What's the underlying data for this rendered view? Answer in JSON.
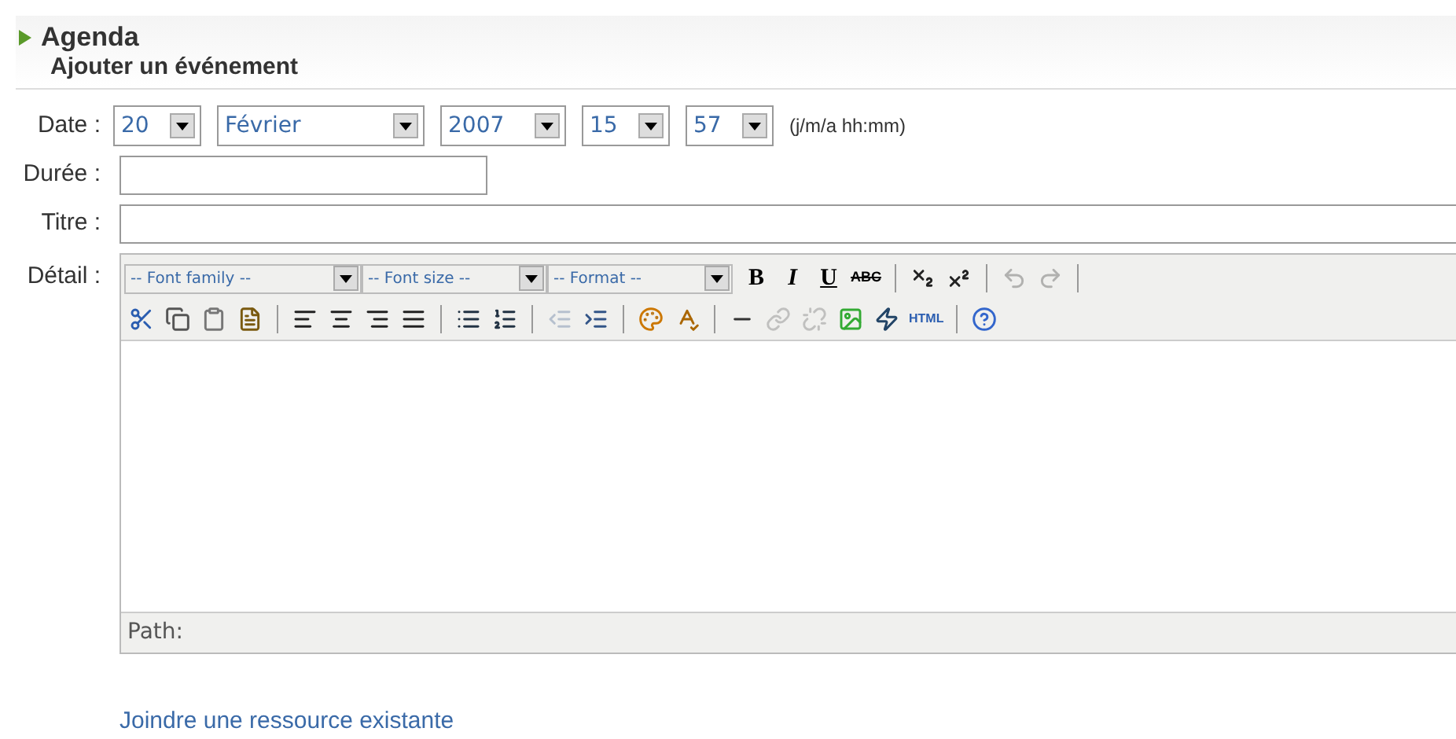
{
  "header": {
    "title": "Agenda",
    "subtitle": "Ajouter un événement"
  },
  "date": {
    "label": "Date :",
    "selects": [
      {
        "value": "20"
      },
      {
        "value": "Février"
      },
      {
        "value": "2007"
      },
      {
        "value": "15"
      },
      {
        "value": "57"
      }
    ],
    "hint": "(j/m/a hh:mm)"
  },
  "duration": {
    "label": "Durée :"
  },
  "title_field": {
    "label": "Titre :"
  },
  "detail": {
    "label": "Détail :",
    "dropdowns": [
      {
        "value": "-- Font family --"
      },
      {
        "value": "-- Font size --"
      },
      {
        "value": "-- Format --"
      }
    ],
    "row_1": [
      {
        "kind": "text",
        "label": "B",
        "disabled": false
      },
      {
        "kind": "text",
        "label": "I",
        "disabled": false
      },
      {
        "kind": "text",
        "label": "U",
        "disabled": false
      },
      {
        "kind": "text",
        "label": "ABC",
        "disabled": false
      },
      {
        "kind": "separator"
      },
      {
        "kind": "icon",
        "disabled": false
      },
      {
        "kind": "icon",
        "disabled": false
      },
      {
        "kind": "separator"
      },
      {
        "kind": "icon",
        "disabled": true
      },
      {
        "kind": "icon",
        "disabled": true
      },
      {
        "kind": "separator"
      }
    ],
    "row_2": [
      {
        "kind": "icon",
        "disabled": false
      },
      {
        "kind": "icon",
        "disabled": false
      },
      {
        "kind": "icon",
        "disabled": false
      },
      {
        "kind": "icon",
        "disabled": false
      },
      {
        "kind": "separator"
      },
      {
        "kind": "icon",
        "disabled": false
      },
      {
        "kind": "icon",
        "disabled": false
      },
      {
        "kind": "icon",
        "disabled": false
      },
      {
        "kind": "icon",
        "disabled": false
      },
      {
        "kind": "separator"
      },
      {
        "kind": "icon",
        "disabled": false
      },
      {
        "kind": "icon",
        "disabled": false
      },
      {
        "kind": "separator"
      },
      {
        "kind": "icon",
        "disabled": true
      },
      {
        "kind": "icon",
        "disabled": false
      },
      {
        "kind": "separator"
      },
      {
        "kind": "icon",
        "disabled": false
      },
      {
        "kind": "icon",
        "disabled": false
      },
      {
        "kind": "separator"
      },
      {
        "kind": "icon",
        "disabled": false
      },
      {
        "kind": "icon",
        "disabled": true
      },
      {
        "kind": "icon",
        "disabled": true
      },
      {
        "kind": "icon",
        "disabled": false
      },
      {
        "kind": "icon",
        "disabled": false
      },
      {
        "kind": "text",
        "label": "HTML",
        "disabled": false
      },
      {
        "kind": "separator"
      },
      {
        "kind": "icon",
        "disabled": false
      }
    ],
    "path_label": "Path:"
  },
  "link": "Joindre une ressource existante"
}
